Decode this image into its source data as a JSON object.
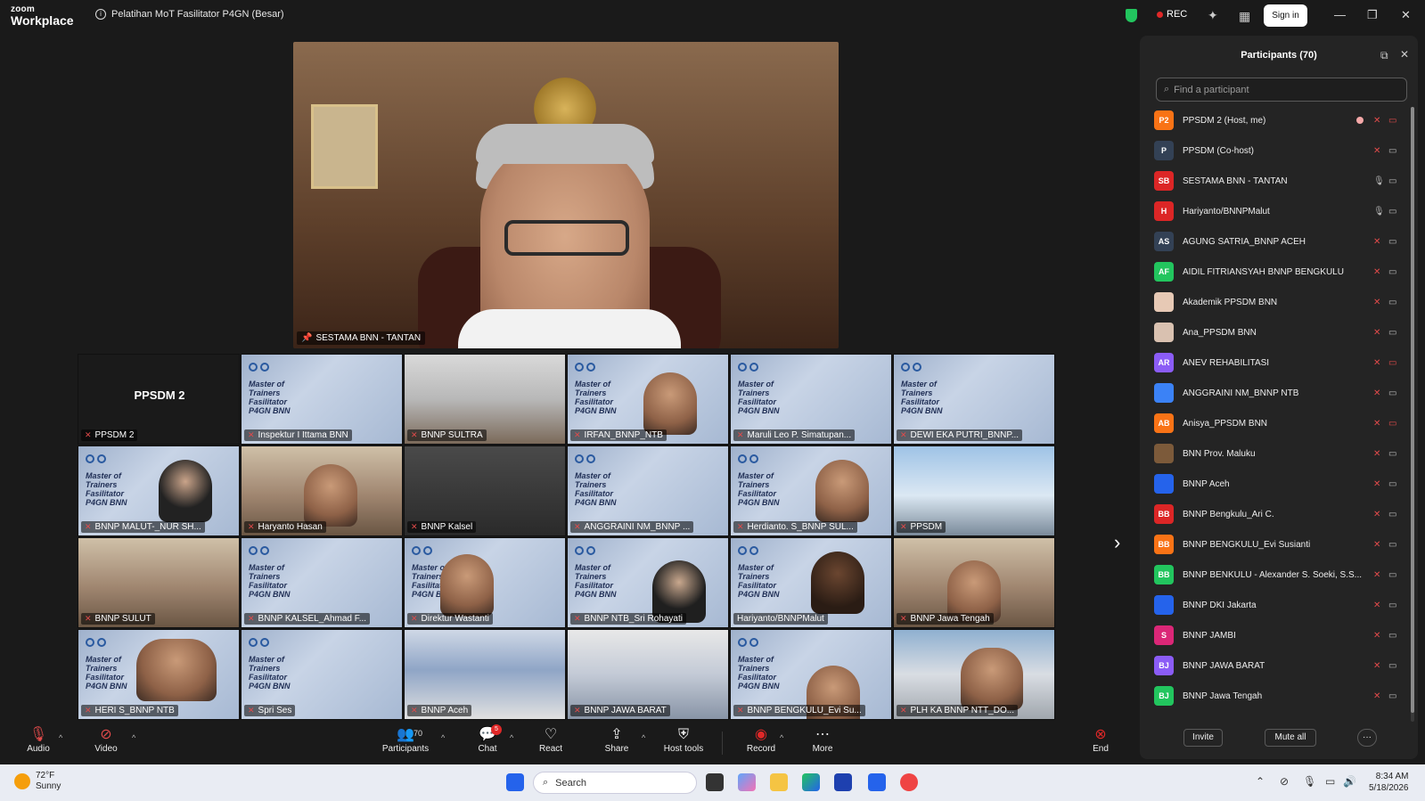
{
  "app": {
    "brand_top": "zoom",
    "brand_bottom": "Workplace",
    "meeting_title": "Pelatihan MoT Fasilitator P4GN (Besar)",
    "rec_label": "REC",
    "signin_label": "Sign in"
  },
  "speaker": {
    "name": "SESTAMA BNN - TANTAN"
  },
  "gallery": {
    "self_tile_name": "PPSDM 2",
    "self_label": "PPSDM 2",
    "slide_text": [
      "Master of",
      "Trainers",
      "Fasilitator",
      "P4GN BNN"
    ],
    "tiles": [
      "Inspektur I Ittama BNN",
      "BNNP SULTRA",
      "IRFAN_BNNP_NTB",
      "Maruli Leo P. Simatupan...",
      "DEWI EKA PUTRI_BNNP...",
      "BNNP MALUT-_NUR SH...",
      "Haryanto Hasan",
      "BNNP Kalsel",
      "ANGGRAINI NM_BNNP ...",
      "Herdianto. S_BNNP SUL...",
      "PPSDM",
      "BNNP SULUT",
      "BNNP KALSEL_Ahmad F...",
      "Direktur Wastanti",
      "BNNP NTB_Sri Rohayati",
      "Hariyanto/BNNPMalut",
      "BNNP Jawa Tengah",
      "HERI S_BNNP NTB",
      "Spri Ses",
      "BNNP Aceh",
      "BNNP JAWA BARAT",
      "BNNP BENGKULU_Evi Su...",
      "PLH KA BNNP NTT_DO..."
    ]
  },
  "participants_panel": {
    "title": "Participants (70)",
    "search_placeholder": "Find a participant",
    "items": [
      {
        "initials": "P2",
        "name": "PPSDM 2 (Host, me)",
        "color": "#f97316"
      },
      {
        "initials": "P",
        "name": "PPSDM (Co-host)",
        "color": "#334155"
      },
      {
        "initials": "SB",
        "name": "SESTAMA BNN - TANTAN",
        "color": "#dc2626"
      },
      {
        "initials": "H",
        "name": "Hariyanto/BNNPMalut",
        "color": "#dc2626"
      },
      {
        "initials": "AS",
        "name": "AGUNG SATRIA_BNNP ACEH",
        "color": "#334155"
      },
      {
        "initials": "AF",
        "name": "AIDIL FITRIANSYAH BNNP BENGKULU",
        "color": "#22c55e"
      },
      {
        "initials": "",
        "name": "Akademik PPSDM BNN",
        "color": "#e7c9b5"
      },
      {
        "initials": "",
        "name": "Ana_PPSDM BNN",
        "color": "#d9c1b0"
      },
      {
        "initials": "AR",
        "name": "ANEV REHABILITASI",
        "color": "#8b5cf6"
      },
      {
        "initials": "",
        "name": "ANGGRAINI NM_BNNP NTB",
        "color": "#3b82f6"
      },
      {
        "initials": "AB",
        "name": "Anisya_PPSDM BNN",
        "color": "#f97316"
      },
      {
        "initials": "",
        "name": "BNN Prov. Maluku",
        "color": "#7c5a3a"
      },
      {
        "initials": "",
        "name": "BNNP Aceh",
        "color": "#2563eb"
      },
      {
        "initials": "BB",
        "name": "BNNP Bengkulu_Ari C.",
        "color": "#dc2626"
      },
      {
        "initials": "BB",
        "name": "BNNP BENGKULU_Evi Susianti",
        "color": "#f97316"
      },
      {
        "initials": "BB",
        "name": "BNNP BENKULU - Alexander S. Soeki, S.S...",
        "color": "#22c55e"
      },
      {
        "initials": "",
        "name": "BNNP DKI Jakarta",
        "color": "#2563eb"
      },
      {
        "initials": "S",
        "name": "BNNP JAMBI",
        "color": "#db2777"
      },
      {
        "initials": "BJ",
        "name": "BNNP JAWA BARAT",
        "color": "#8b5cf6"
      },
      {
        "initials": "BJ",
        "name": "BNNP Jawa Tengah",
        "color": "#22c55e"
      }
    ],
    "invite_label": "Invite",
    "mute_all_label": "Mute all",
    "more_label": "···"
  },
  "toolbar": {
    "audio": "Audio",
    "video": "Video",
    "participants": "Participants",
    "participants_count": "70",
    "chat": "Chat",
    "chat_badge": "5",
    "react": "React",
    "share": "Share",
    "host_tools": "Host tools",
    "record": "Record",
    "more": "More",
    "end": "End"
  },
  "taskbar": {
    "temp": "72°F",
    "condition": "Sunny",
    "search": "Search",
    "time": "8:34 AM",
    "date": "5/18/2026"
  }
}
